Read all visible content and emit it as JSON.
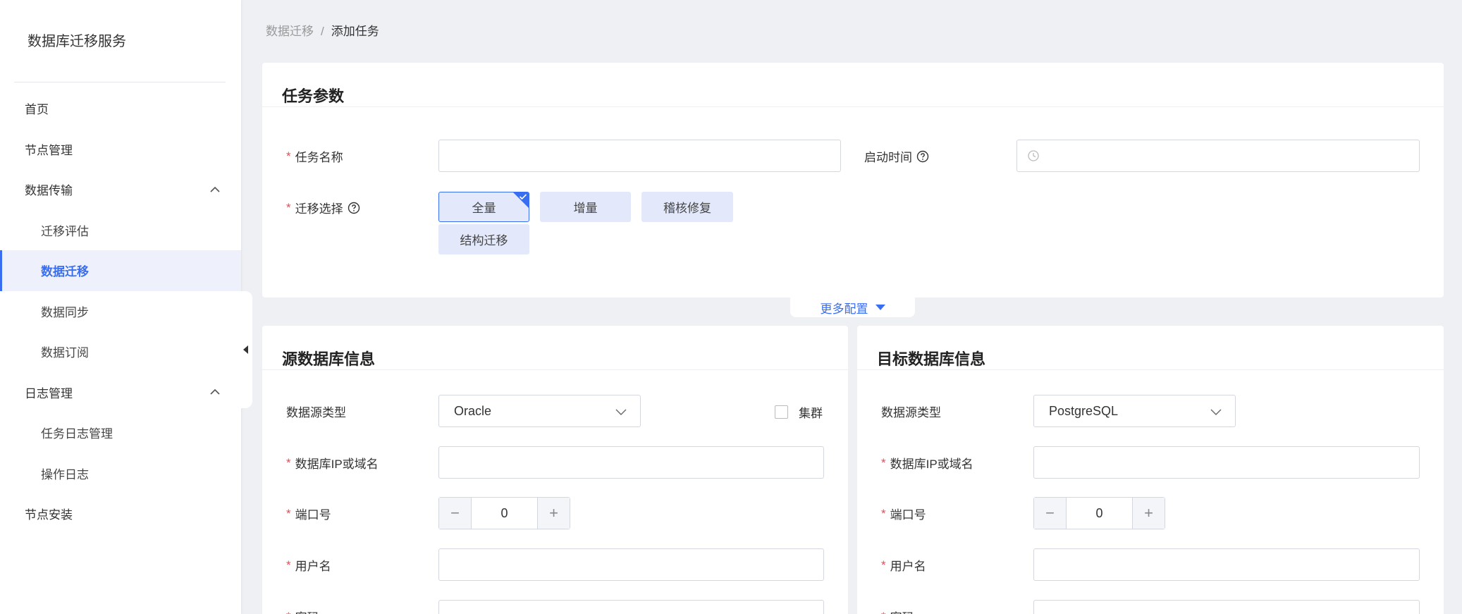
{
  "sidebar": {
    "title": "数据库迁移服务",
    "items": [
      {
        "label": "首页"
      },
      {
        "label": "节点管理"
      },
      {
        "label": "数据传输"
      },
      {
        "label": "迁移评估"
      },
      {
        "label": "数据迁移"
      },
      {
        "label": "数据同步"
      },
      {
        "label": "数据订阅"
      },
      {
        "label": "日志管理"
      },
      {
        "label": "任务日志管理"
      },
      {
        "label": "操作日志"
      },
      {
        "label": "节点安装"
      }
    ]
  },
  "breadcrumb": {
    "parent": "数据迁移",
    "separator": "/",
    "current": "添加任务"
  },
  "task_params": {
    "title": "任务参数",
    "name_label": "任务名称",
    "start_time_label": "启动时间",
    "migration_label": "迁移选择",
    "options": [
      "全量",
      "增量",
      "稽核修复",
      "结构迁移"
    ],
    "selected_option": "全量",
    "required_mark": "*"
  },
  "more_config": "更多配置",
  "source": {
    "title": "源数据库信息",
    "type_label": "数据源类型",
    "type_value": "Oracle",
    "cluster_label": "集群",
    "ip_label": "数据库IP或域名",
    "port_label": "端口号",
    "port_value": "0",
    "user_label": "用户名",
    "password_label": "密码"
  },
  "target": {
    "title": "目标数据库信息",
    "type_label": "数据源类型",
    "type_value": "PostgreSQL",
    "ip_label": "数据库IP或域名",
    "port_label": "端口号",
    "port_value": "0",
    "user_label": "用户名",
    "password_label": "密码"
  },
  "colors": {
    "accent": "#3a6ef0",
    "required": "#e34d59",
    "chip_bg": "#e3e9fa",
    "page_bg": "#eff0f4"
  }
}
